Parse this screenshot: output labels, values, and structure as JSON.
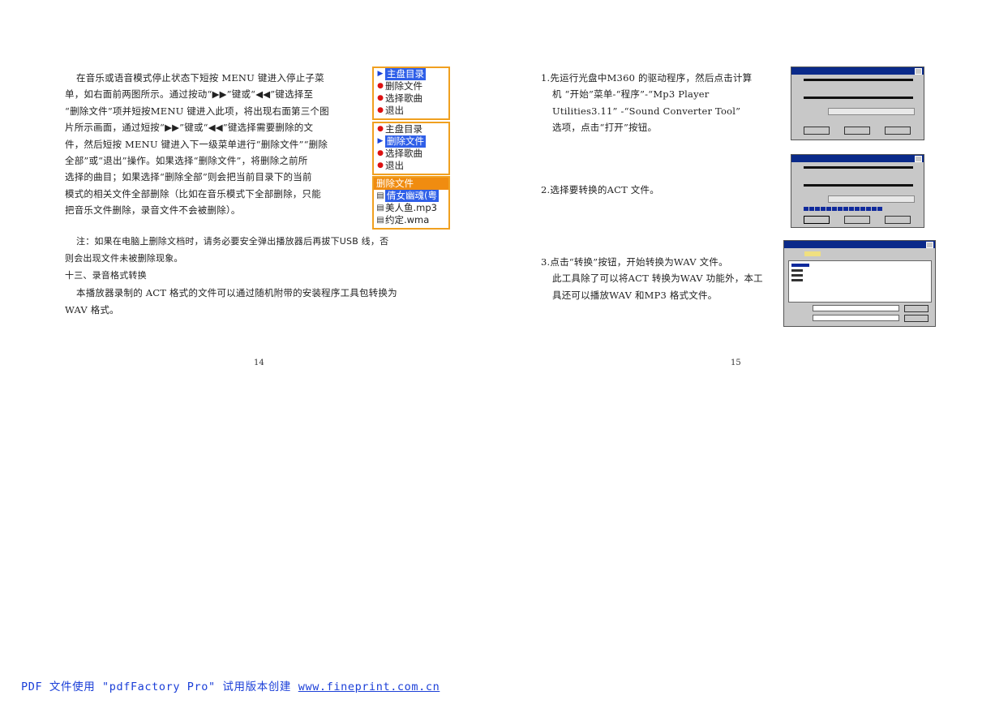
{
  "left_page": {
    "paragraph_lines": [
      "在音乐或语音模式停止状态下短按 MENU 键进入停止子菜",
      "单，如右面前两图所示。通过按动“▶▶”键或“◀◀”键选择至",
      "“删除文件”项并短按MENU 键进入此项，将出现右面第三个图",
      "片所示画面，通过短按“▶▶”键或“◀◀”键选择需要删除的文",
      "件，然后短按 MENU 键进入下一级菜单进行“删除文件”“删除",
      "全部”或“退出”操作。如果选择“删除文件”，将删除之前所",
      "选择的曲目；如果选择“删除全部”则会把当前目录下的当前",
      "模式的相关文件全部删除（比如在音乐模式下全部删除，只能",
      "把音乐文件删除，录音文件不会被删除）。"
    ],
    "note_line1": "注：如果在电脑上删除文档时，请务必要安全弹出播放器后再拔下USB 线，否",
    "note_line2": "则会出现文件未被删除现象。",
    "section_heading": "十三、录音格式转换",
    "section_text_line1": "本播放器录制的 ACT 格式的文件可以通过随机附带的安装程序工具包转换为",
    "section_text_line2": "WAV 格式。",
    "page_number": "14",
    "menu1": {
      "items": [
        {
          "label": "主盘目录",
          "marker": "▶",
          "selected": true
        },
        {
          "label": "删除文件",
          "marker": "●",
          "selected": false
        },
        {
          "label": "选择歌曲",
          "marker": "●",
          "selected": false
        },
        {
          "label": "退出",
          "marker": "●",
          "selected": false
        }
      ]
    },
    "menu2": {
      "items": [
        {
          "label": "主盘目录",
          "marker": "●",
          "selected": false
        },
        {
          "label": "删除文件",
          "marker": "▶",
          "selected": true
        },
        {
          "label": "选择歌曲",
          "marker": "●",
          "selected": false
        },
        {
          "label": "退出",
          "marker": "●",
          "selected": false
        }
      ]
    },
    "menu3": {
      "header": "删除文件",
      "files": [
        {
          "label": "倩女幽魂(粤",
          "selected": true
        },
        {
          "label": "美人鱼.mp3",
          "selected": false
        },
        {
          "label": "约定.wma",
          "selected": false
        }
      ]
    }
  },
  "right_page": {
    "step1_lines": [
      "1.先运行光盘中M360 的驱动程序，然后点击计算",
      "机 “开始”菜单-“程序”-“Mp3 Player",
      "Utilities3.11” -“Sound Converter Tool”",
      "选项，点击“打开”按钮。"
    ],
    "step2": "2.选择要转换的ACT 文件。",
    "step3_lines": [
      "3.点击“转换”按钮，开始转换为WAV 文件。",
      "此工具除了可以将ACT 转换为WAV 功能外，本工",
      "具还可以播放WAV 和MP3 格式文件。"
    ],
    "page_number": "15"
  },
  "footer": {
    "prefix": "PDF 文件使用 \"pdfFactory Pro\" 试用版本创建 ",
    "link": "www.fineprint.com.cn"
  },
  "colors": {
    "menu_border": "#f0a020",
    "menu_selected": "#2f5fe8",
    "menu_bullet": "#dd1111",
    "file_header": "#f08c10",
    "link": "#1b3fd8",
    "dialog_title": "#0a2a8a"
  }
}
